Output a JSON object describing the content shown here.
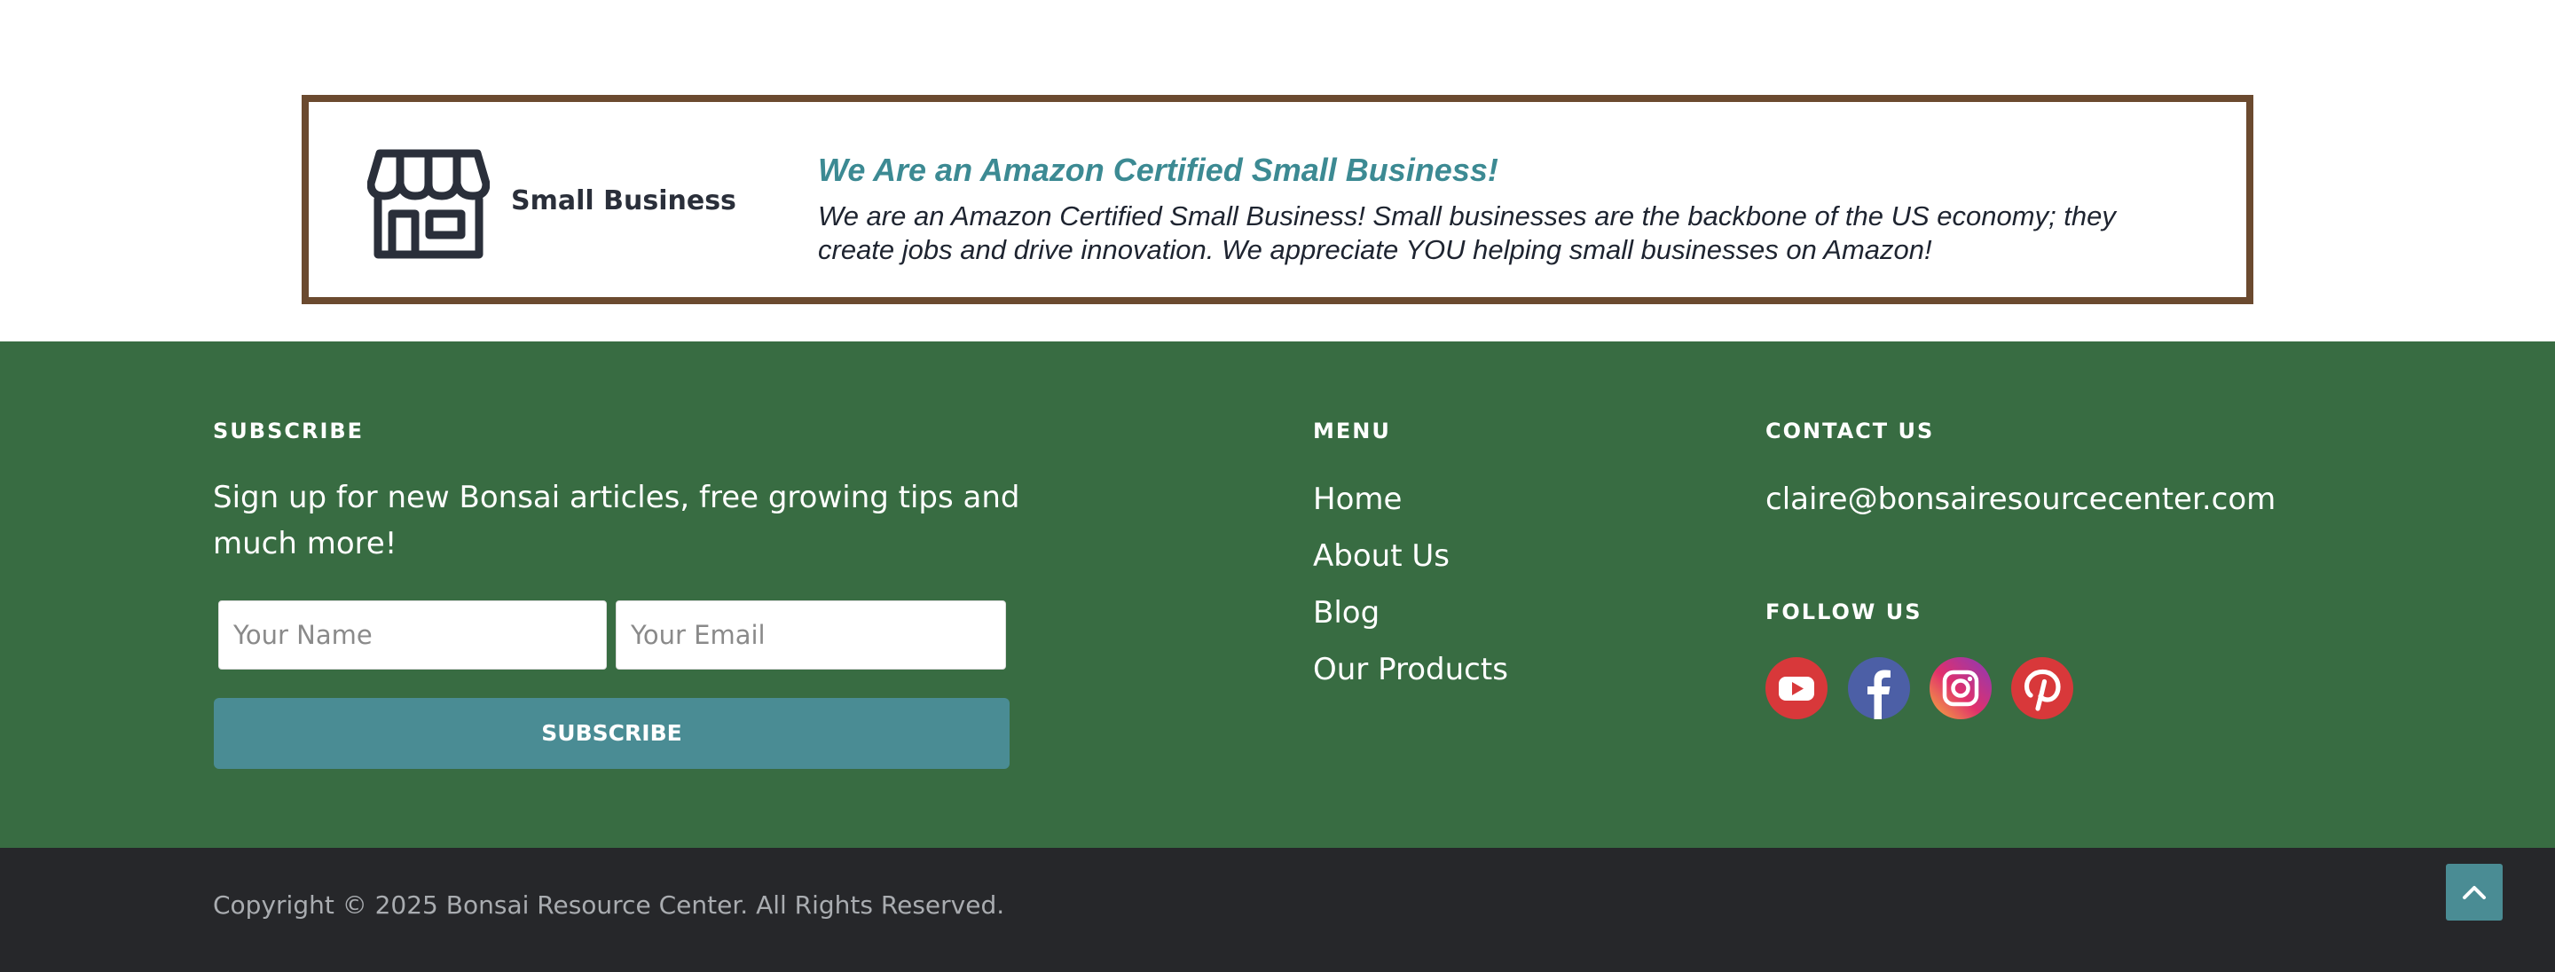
{
  "cert_banner": {
    "badge_label": "Small Business",
    "title": "We Are an Amazon Certified Small Business!",
    "text": "We are an Amazon Certified Small Business! Small businesses are the backbone of the US economy; they create jobs and drive innovation. We appreciate YOU helping small businesses on Amazon!",
    "icon": "storefront-icon"
  },
  "subscribe": {
    "heading": "SUBSCRIBE",
    "text": "Sign up for new Bonsai articles, free growing tips and much more!",
    "name_placeholder": "Your Name",
    "email_placeholder": "Your Email",
    "button_label": "SUBSCRIBE"
  },
  "menu": {
    "heading": "MENU",
    "items": [
      {
        "label": "Home"
      },
      {
        "label": "About Us"
      },
      {
        "label": "Blog"
      },
      {
        "label": "Our Products"
      }
    ]
  },
  "contact": {
    "heading": "CONTACT US",
    "email": "claire@bonsairesourcecenter.com"
  },
  "follow": {
    "heading": "FOLLOW US",
    "icons": [
      "youtube-icon",
      "facebook-icon",
      "instagram-icon",
      "pinterest-icon"
    ]
  },
  "bottom": {
    "copyright": "Copyright © 2025 Bonsai Resource Center. All Rights Reserved.",
    "back_to_top_icon": "chevron-up-icon"
  },
  "colors": {
    "banner_border": "#6b4a2f",
    "accent_teal": "#4a8c94",
    "footer_green": "#386c42",
    "footer_dark": "#26272a"
  }
}
